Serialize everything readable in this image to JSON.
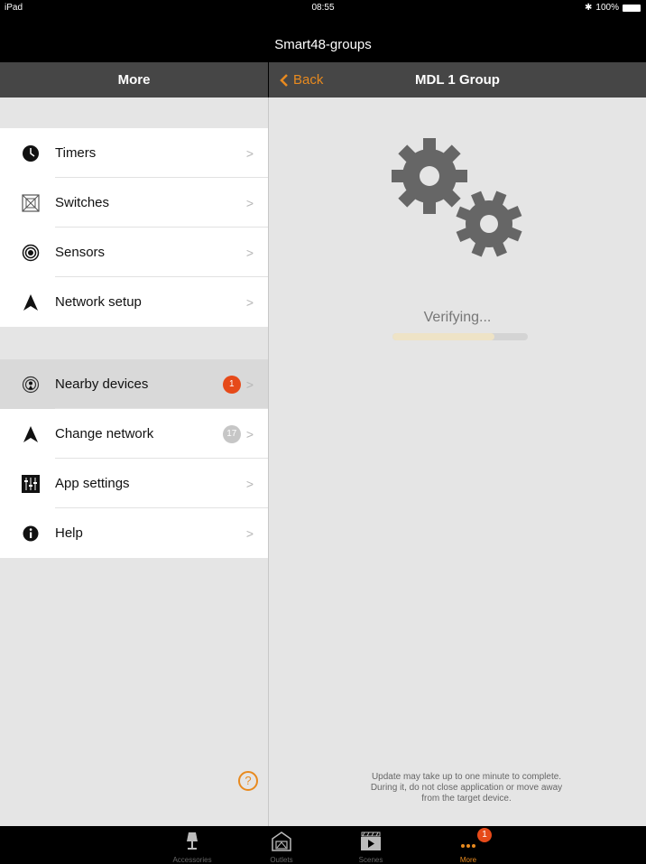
{
  "status_bar": {
    "device": "iPad",
    "time": "08:55",
    "battery": "100%"
  },
  "app_title": "Smart48-groups",
  "left_header": {
    "title": "More"
  },
  "right_header": {
    "back_label": "Back",
    "title": "MDL 1 Group"
  },
  "menu": {
    "group1": [
      {
        "label": "Timers",
        "icon": "clock-icon"
      },
      {
        "label": "Switches",
        "icon": "switch-icon"
      },
      {
        "label": "Sensors",
        "icon": "sensor-icon"
      },
      {
        "label": "Network setup",
        "icon": "network-icon"
      }
    ],
    "group2": [
      {
        "label": "Nearby devices",
        "icon": "nearby-icon",
        "badge": "1"
      },
      {
        "label": "Change network",
        "icon": "network-icon",
        "badge": "17"
      },
      {
        "label": "App settings",
        "icon": "settings-sliders-icon"
      },
      {
        "label": "Help",
        "icon": "info-icon"
      }
    ]
  },
  "help_icon_glyph": "?",
  "detail": {
    "status": "Verifying...",
    "progress": 0.75,
    "note_lines": [
      "Update may take up to one minute to complete.",
      "During it, do not close application or move away",
      "from the target device."
    ]
  },
  "tab_bar": {
    "tabs": [
      {
        "icon": "lamp-icon",
        "label": "Accessories"
      },
      {
        "icon": "scene-icon",
        "label": "Outlets"
      },
      {
        "icon": "scenes-icon",
        "label": "Scenes"
      },
      {
        "icon": "more-dots-icon",
        "label": "More",
        "badge": "1"
      }
    ]
  },
  "colors": {
    "accent": "#e88a1f",
    "badge": "#e64a19",
    "header": "#464646",
    "background": "#e5e5e5"
  }
}
